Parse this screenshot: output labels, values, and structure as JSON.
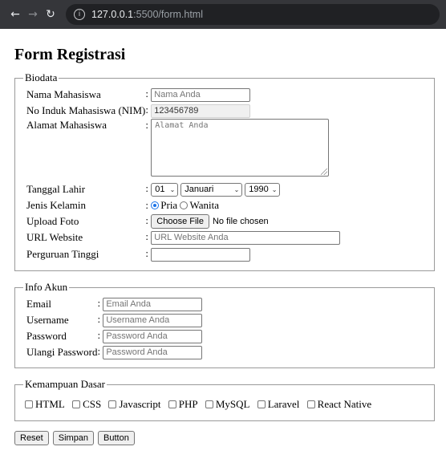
{
  "browser": {
    "url_host": "127.0.0.1",
    "url_path": ":5500/form.html"
  },
  "page_title": "Form Registrasi",
  "colon": ":",
  "biodata": {
    "legend": "Biodata",
    "nama": {
      "label": "Nama Mahasiswa",
      "placeholder": "Nama Anda"
    },
    "nim": {
      "label": "No Induk Mahasiswa (NIM)",
      "value": "123456789"
    },
    "alamat": {
      "label": "Alamat Mahasiswa",
      "placeholder": "Alamat Anda"
    },
    "tanggal": {
      "label": "Tanggal Lahir",
      "day": "01",
      "month": "Januari",
      "year": "1990"
    },
    "kelamin": {
      "label": "Jenis Kelamin",
      "opt1": "Pria",
      "opt2": "Wanita",
      "selected": "Pria"
    },
    "foto": {
      "label": "Upload Foto",
      "button": "Choose File",
      "status": "No file chosen"
    },
    "website": {
      "label": "URL Website",
      "placeholder": "URL Website Anda"
    },
    "pt": {
      "label": "Perguruan Tinggi",
      "placeholder": ""
    }
  },
  "akun": {
    "legend": "Info Akun",
    "email": {
      "label": "Email",
      "placeholder": "Email Anda"
    },
    "username": {
      "label": "Username",
      "placeholder": "Username Anda"
    },
    "password": {
      "label": "Password",
      "placeholder": "Password Anda"
    },
    "ulangi": {
      "label": "Ulangi Password",
      "placeholder": "Password Anda"
    }
  },
  "kemampuan": {
    "legend": "Kemampuan Dasar",
    "items": [
      "HTML",
      "CSS",
      "Javascript",
      "PHP",
      "MySQL",
      "Laravel",
      "React Native"
    ]
  },
  "actions": {
    "reset": "Reset",
    "simpan": "Simpan",
    "button": "Button"
  },
  "colors": {
    "accent": "#1a73e8",
    "chrome_bg": "#35363a"
  }
}
